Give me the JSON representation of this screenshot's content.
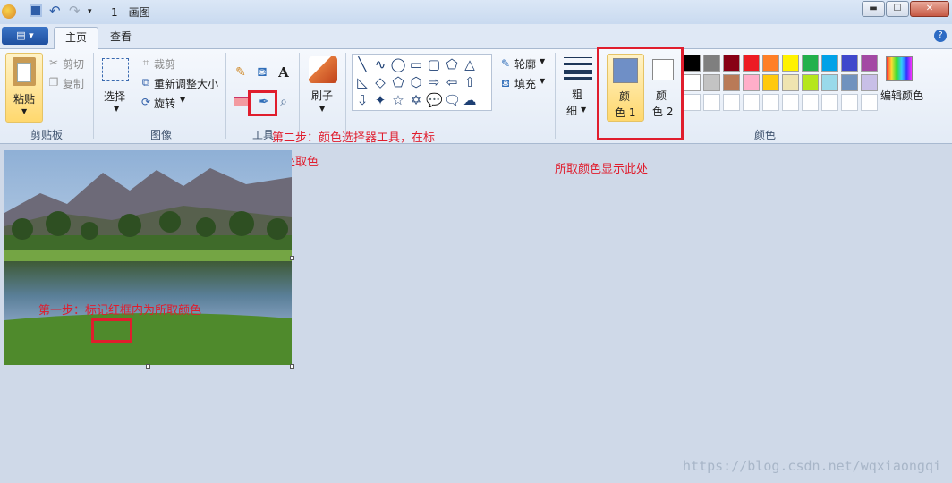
{
  "window": {
    "title": "1 - 画图",
    "minimize": "▬",
    "maximize": "☐",
    "close": "✕"
  },
  "tabs": {
    "app_menu": "▤ ▾",
    "home": "主页",
    "view": "查看",
    "help": "?"
  },
  "clipboard": {
    "paste": "粘贴",
    "cut": "剪切",
    "copy": "复制",
    "group": "剪贴板"
  },
  "image": {
    "select": "选择",
    "crop": "裁剪",
    "resize": "重新调整大小",
    "rotate": "旋转",
    "group": "图像"
  },
  "tools": {
    "group": "工具",
    "pencil_icon": "pencil-icon",
    "fill_icon": "fill-icon",
    "text_icon": "A",
    "eraser_icon": "eraser-icon",
    "picker_icon": "color-picker-icon",
    "magnifier_icon": "magnifier-icon"
  },
  "brush": {
    "label": "刷子"
  },
  "shapes": {
    "outline": "轮廓",
    "fill": "填充",
    "symbols": [
      "╲",
      "∿",
      "◯",
      "▭",
      "▢",
      "⬠",
      "△",
      "◺",
      "◇",
      "⬠",
      "⬡",
      "⇨",
      "⇦",
      "⇧",
      "⇩",
      "✦",
      "☆",
      "✡",
      "💬",
      "🗨",
      "☁"
    ]
  },
  "size": {
    "label1": "粗",
    "label2": "细"
  },
  "colors": {
    "color1_label1": "颜",
    "color1_label2": "色 1",
    "color2_label1": "颜",
    "color2_label2": "色 2",
    "color1_value": "#6f8fc6",
    "color2_value": "#ffffff",
    "group": "颜色",
    "edit": "编辑颜色",
    "palette_row1": [
      "#000000",
      "#7f7f7f",
      "#880015",
      "#ed1c24",
      "#ff7f27",
      "#fff200",
      "#22b14c",
      "#00a2e8",
      "#3f48cc",
      "#a349a4"
    ],
    "palette_row2": [
      "#ffffff",
      "#c3c3c3",
      "#b97a57",
      "#ffaec9",
      "#ffc90e",
      "#efe4b0",
      "#b5e61d",
      "#99d9ea",
      "#7092be",
      "#c8bfe7"
    ],
    "palette_row3": [
      "#ffffff",
      "#ffffff",
      "#ffffff",
      "#ffffff",
      "#ffffff",
      "#ffffff",
      "#ffffff",
      "#ffffff",
      "#ffffff",
      "#ffffff"
    ]
  },
  "annotations": {
    "step2_line1": "第二步：颜色选择器工具，在标",
    "step2_line2": "记处取色",
    "result": "所取颜色显示此处",
    "step1": "第一步：标记红框内为所取颜色"
  },
  "watermark": "https://blog.csdn.net/wqxiaongqi"
}
